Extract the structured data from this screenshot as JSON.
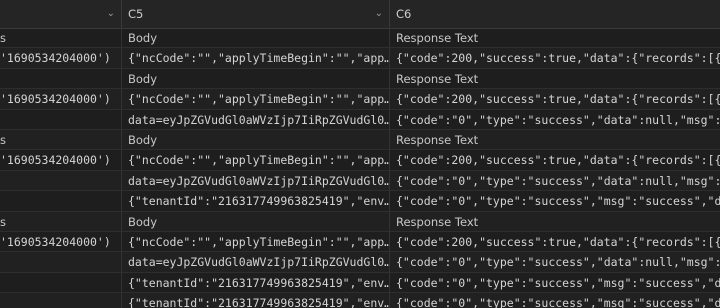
{
  "columns": {
    "a": {
      "label": "s"
    },
    "b": {
      "label": "C5"
    },
    "c": {
      "label": "C6"
    }
  },
  "rows": [
    {
      "type": "header",
      "a": "s",
      "b": "Body",
      "c": "Response Text"
    },
    {
      "type": "data",
      "a": " '1690534204000')",
      "b": "{\"ncCode\":\"\",\"applyTimeBegin\":\"\",\"app…",
      "c": "{\"code\":200,\"success\":true,\"data\":{\"records\":[{\""
    },
    {
      "type": "header",
      "a": "",
      "b": "Body",
      "c": "Response Text"
    },
    {
      "type": "data",
      "a": " '1690534204000')",
      "b": "{\"ncCode\":\"\",\"applyTimeBegin\":\"\",\"app…",
      "c": "{\"code\":200,\"success\":true,\"data\":{\"records\":[{\""
    },
    {
      "type": "data",
      "a": "",
      "b": "data=eyJpZGVudGl0aWVzIjp7IiRpZGVudGl0…",
      "c": "{\"code\":\"0\",\"type\":\"success\",\"data\":null,\"msg\":\""
    },
    {
      "type": "header",
      "a": "s",
      "b": "Body",
      "c": "Response Text"
    },
    {
      "type": "data",
      "a": " '1690534204000')",
      "b": "{\"ncCode\":\"\",\"applyTimeBegin\":\"\",\"app…",
      "c": "{\"code\":200,\"success\":true,\"data\":{\"records\":[{\""
    },
    {
      "type": "data",
      "a": "",
      "b": "data=eyJpZGVudGl0aWVzIjp7IiRpZGVudGl0…",
      "c": "{\"code\":\"0\",\"type\":\"success\",\"data\":null,\"msg\":\""
    },
    {
      "type": "data",
      "a": "",
      "b": "{\"tenantId\":\"216317749963825419\",\"env…",
      "c": "{\"code\":\"0\",\"type\":\"success\",\"msg\":\"success\",\"da"
    },
    {
      "type": "header",
      "a": "s",
      "b": "Body",
      "c": "Response Text"
    },
    {
      "type": "data",
      "a": " '1690534204000')",
      "b": "{\"ncCode\":\"\",\"applyTimeBegin\":\"\",\"app…",
      "c": "{\"code\":200,\"success\":true,\"data\":{\"records\":[{\""
    },
    {
      "type": "data",
      "a": "",
      "b": "data=eyJpZGVudGl0aWVzIjp7IiRpZGVudGl0…",
      "c": "{\"code\":\"0\",\"type\":\"success\",\"data\":null,\"msg\":\""
    },
    {
      "type": "data",
      "a": "",
      "b": "{\"tenantId\":\"216317749963825419\",\"env…",
      "c": "{\"code\":\"0\",\"type\":\"success\",\"msg\":\"success\",\"da"
    },
    {
      "type": "data",
      "a": "",
      "b": "{\"tenantId\":\"216317749963825419\",\"env…",
      "c": "{\"code\":\"0\",\"type\":\"success\",\"msg\":\"success\",\"da"
    }
  ],
  "icons": {
    "column_menu": "chevron-down-icon"
  }
}
